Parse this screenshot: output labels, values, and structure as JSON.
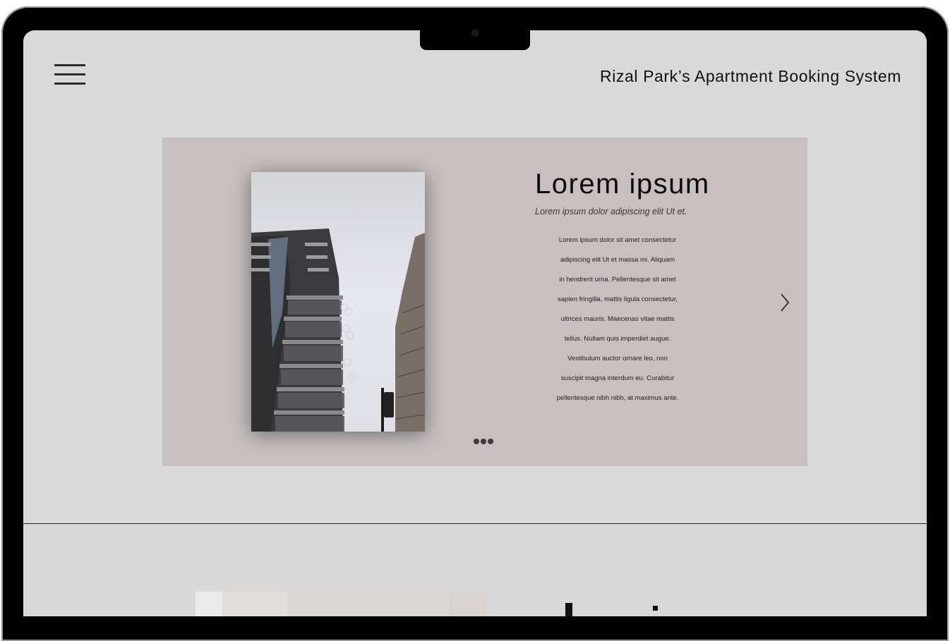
{
  "header": {
    "site_title": "Rizal Park’s Apartment Booking System",
    "menu_icon": "hamburger-menu-icon"
  },
  "slider": {
    "heading": "Lorem ipsum",
    "subtitle": "Lorem ipsum dolor adipiscing elit Ut et.",
    "body_lines": [
      "Lorem ipsum dolor sit amet consectetur",
      "adipiscing elit Ut et massa mi. Aliquam",
      "in hendrerit urna. Pellentesque sit amet",
      "sapien fringilla, mattis ligula consectetur,",
      "ultrices mauris. Maecenas vitae mattis",
      "tellus. Nullam quis imperdiet augue.",
      "Vestibulum auctor ornare leo, non",
      "suscipit magna interdum eu. Curabitur",
      "pellentesque nibh nibh, at maximus ante."
    ],
    "next_icon": "chevron-right-icon",
    "photo": "apartment-building-photo",
    "dots_count": 3,
    "background": "#c8c0c0"
  },
  "colors": {
    "screen_bg": "#d9d9d9",
    "frame": "#000000",
    "text": "#111111"
  }
}
